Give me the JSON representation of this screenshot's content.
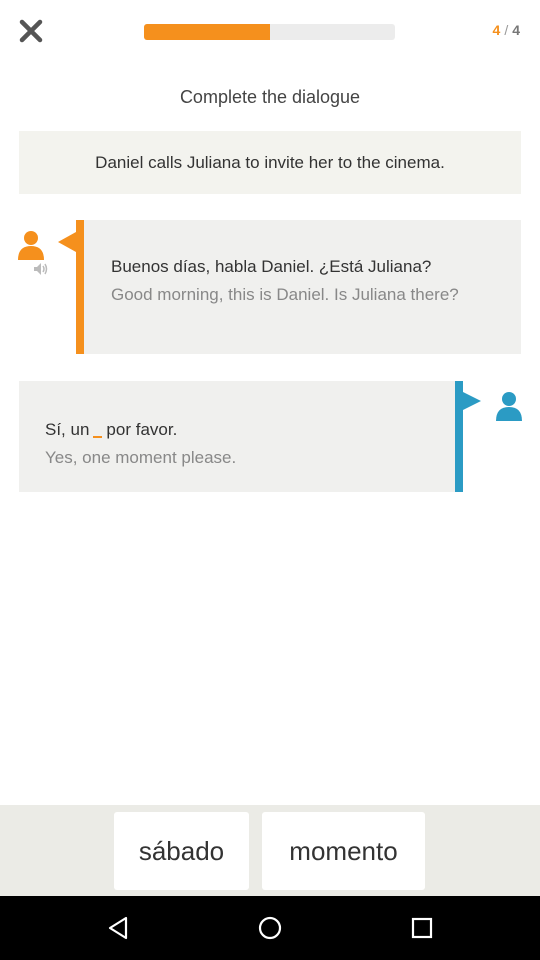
{
  "progress": {
    "current": "4",
    "total": "4",
    "fraction": 0.5
  },
  "instruction": "Complete the dialogue",
  "context": "Daniel calls Juliana to invite her to the cinema.",
  "dialogue": [
    {
      "speaker": "left",
      "spanish": "Buenos días, habla Daniel. ¿Está Juliana?",
      "english": "Good morning, this is Daniel. Is Juliana there?"
    },
    {
      "speaker": "right",
      "spanish_before": "Sí, un",
      "spanish_after": "por favor.",
      "english": "Yes, one moment please."
    }
  ],
  "word_bank": [
    "sábado",
    "momento"
  ],
  "colors": {
    "accent_orange": "#f5901d",
    "accent_blue": "#2b9bc4",
    "bubble_bg": "#f0f0ee"
  },
  "icons": {
    "close": "close-icon",
    "avatar": "person-icon",
    "audio": "speaker-icon",
    "nav_back": "back-triangle-icon",
    "nav_home": "home-circle-icon",
    "nav_recent": "recent-square-icon"
  }
}
